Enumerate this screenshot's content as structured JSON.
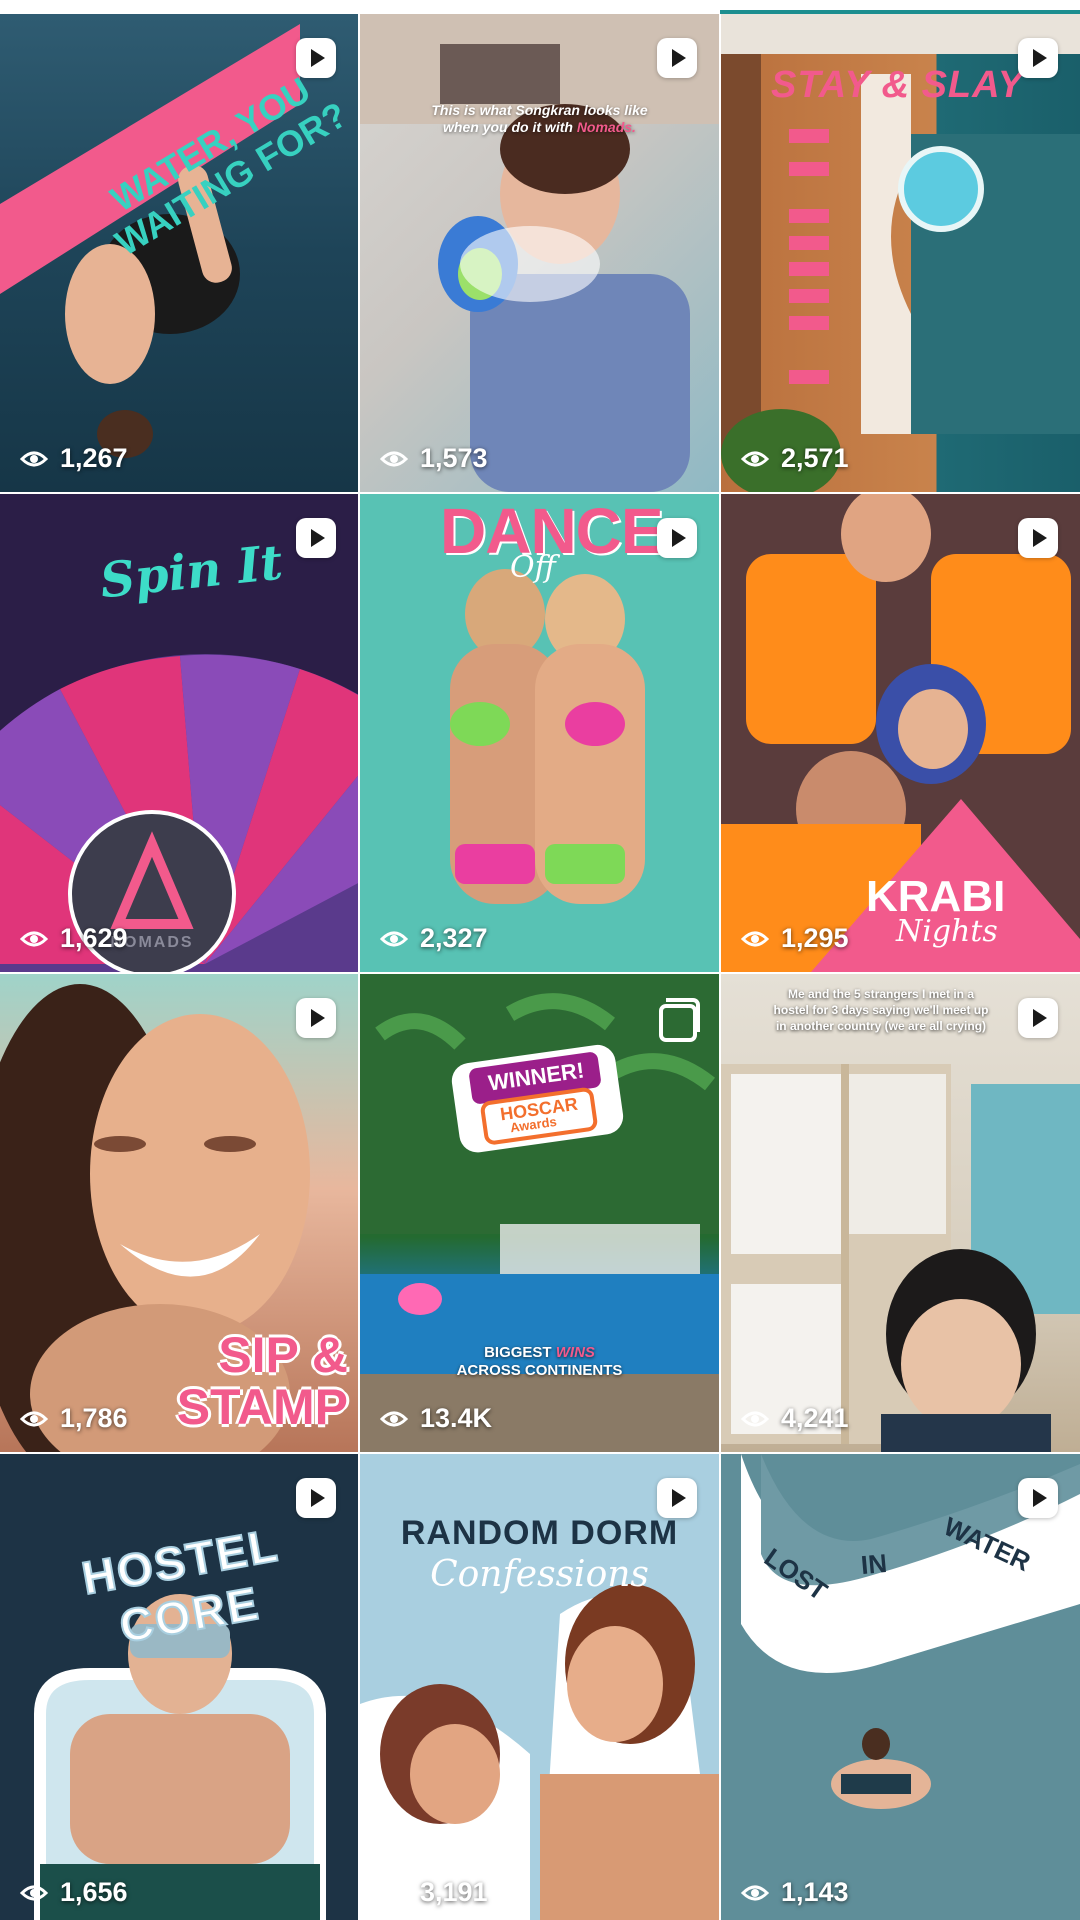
{
  "grid": {
    "tiles": [
      {
        "views": "1,267",
        "type": "reel",
        "title": "WATER, YOU WAITING FOR?"
      },
      {
        "views": "1,573",
        "type": "reel",
        "caption_line1": "This is what Songkran looks like",
        "caption_line2_prefix": "when you do it with ",
        "caption_brand": "Nomads."
      },
      {
        "views": "2,571",
        "type": "reel",
        "title": "STAY & SLAY"
      },
      {
        "views": "1,629",
        "type": "reel",
        "title": "Spin It",
        "logo_text": "NOMADS"
      },
      {
        "views": "2,327",
        "type": "reel",
        "title": "DANCE",
        "subtitle": "Off"
      },
      {
        "views": "1,295",
        "type": "reel",
        "title": "KRABI",
        "subtitle": "Nights"
      },
      {
        "views": "1,786",
        "type": "reel",
        "title_line1": "SIP &",
        "title_line2": "STAMP"
      },
      {
        "views": "13.4K",
        "type": "carousel",
        "badge_top": "WINNER!",
        "badge_mid": "HOSCAR",
        "badge_bottom": "Awards",
        "caption_line1_a": "BIGGEST ",
        "caption_line1_b": "WINS",
        "caption_line2": "ACROSS CONTINENTS"
      },
      {
        "views": "4,241",
        "type": "reel",
        "caption_line1": "Me and the 5 strangers I met in a",
        "caption_line2": "hostel for 3 days saying we'll meet up",
        "caption_line3": "in another country (we are all crying)"
      },
      {
        "views": "1,656",
        "type": "reel",
        "title": "HOSTEL CORE"
      },
      {
        "views": "3,191",
        "type": "reel",
        "title": "RANDOM DORM",
        "subtitle": "Confessions"
      },
      {
        "views": "1,143",
        "type": "reel",
        "title_word1": "LOST",
        "title_word2": "IN",
        "title_word3": "WATER"
      }
    ]
  },
  "colors": {
    "brand_pink": "#f25a8c",
    "brand_teal": "#2bb3a3",
    "top_indicator": "#1c8e8f"
  },
  "icons": {
    "reel": "play-icon",
    "carousel": "carousel-icon",
    "views": "eye-icon"
  }
}
